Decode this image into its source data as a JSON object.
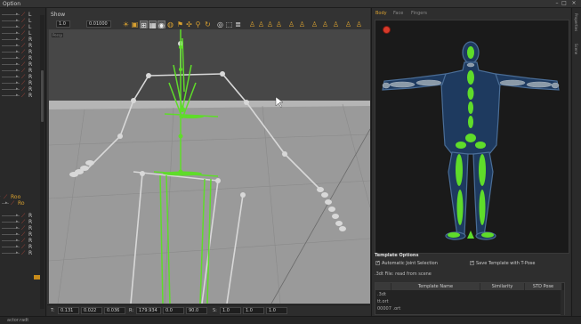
{
  "window": {
    "title": "Option"
  },
  "outliner": {
    "items": [
      {
        "label": "L",
        "kind": "bone"
      },
      {
        "label": "L",
        "kind": "bone"
      },
      {
        "label": "L",
        "kind": "bone"
      },
      {
        "label": "L",
        "kind": "bone"
      },
      {
        "label": "R",
        "kind": "bone"
      },
      {
        "label": "R",
        "kind": "bone"
      },
      {
        "label": "R",
        "kind": "bone"
      },
      {
        "label": "R",
        "kind": "bone"
      },
      {
        "label": "R",
        "kind": "bone"
      },
      {
        "label": "R",
        "kind": "bone"
      },
      {
        "label": "R",
        "kind": "bone"
      },
      {
        "label": "R",
        "kind": "bone"
      },
      {
        "label": "R",
        "kind": "bone"
      },
      {
        "label": "R",
        "kind": "bone"
      },
      {
        "label": "Roo",
        "kind": "root"
      },
      {
        "label": "Ro",
        "kind": "root"
      },
      {
        "label": "R",
        "kind": "bone"
      },
      {
        "label": "R",
        "kind": "bone"
      },
      {
        "label": "R",
        "kind": "bone"
      },
      {
        "label": "R",
        "kind": "bone"
      },
      {
        "label": "R",
        "kind": "bone"
      },
      {
        "label": "R",
        "kind": "bone"
      },
      {
        "label": "R",
        "kind": "bone"
      }
    ]
  },
  "viewport_panel": {
    "show_label": "Show",
    "scale_value": "1.0",
    "frame_value": "0.01000",
    "viewport_label": "Persp",
    "footer": {
      "t_label": "T:",
      "t_values": [
        "0.131",
        "0.022",
        "0.036"
      ],
      "r_label": "R:",
      "r_values": [
        "179.934",
        "0.0",
        "90.0"
      ],
      "s_label": "S:",
      "s_values": [
        "1.0",
        "1.0",
        "1.0"
      ]
    }
  },
  "right_panel": {
    "tabs": [
      "Body",
      "Face",
      "Fingers"
    ],
    "template_options_title": "Template Options",
    "checkbox_auto": "Automatic Joint Selection",
    "checkbox_save": "Save Template with T-Pose",
    "template_file_row": ".3dt File:  read from scene",
    "table": {
      "headers": [
        "",
        "Template Name",
        "Similarity",
        "STD Pose"
      ],
      "rows": [
        ".3dt",
        "tt.ort",
        "00007 .ort"
      ]
    }
  },
  "side_strip": {
    "labels": [
      "Properties",
      "Scene"
    ]
  },
  "status_bar": {
    "text": "actor.radt"
  },
  "colors": {
    "accent": "#d8a030",
    "bone_green": "#5fdc2a",
    "bone_gray": "#d0d0d0",
    "body_blue": "#1e3a5f",
    "record_red": "#d83a2a"
  }
}
